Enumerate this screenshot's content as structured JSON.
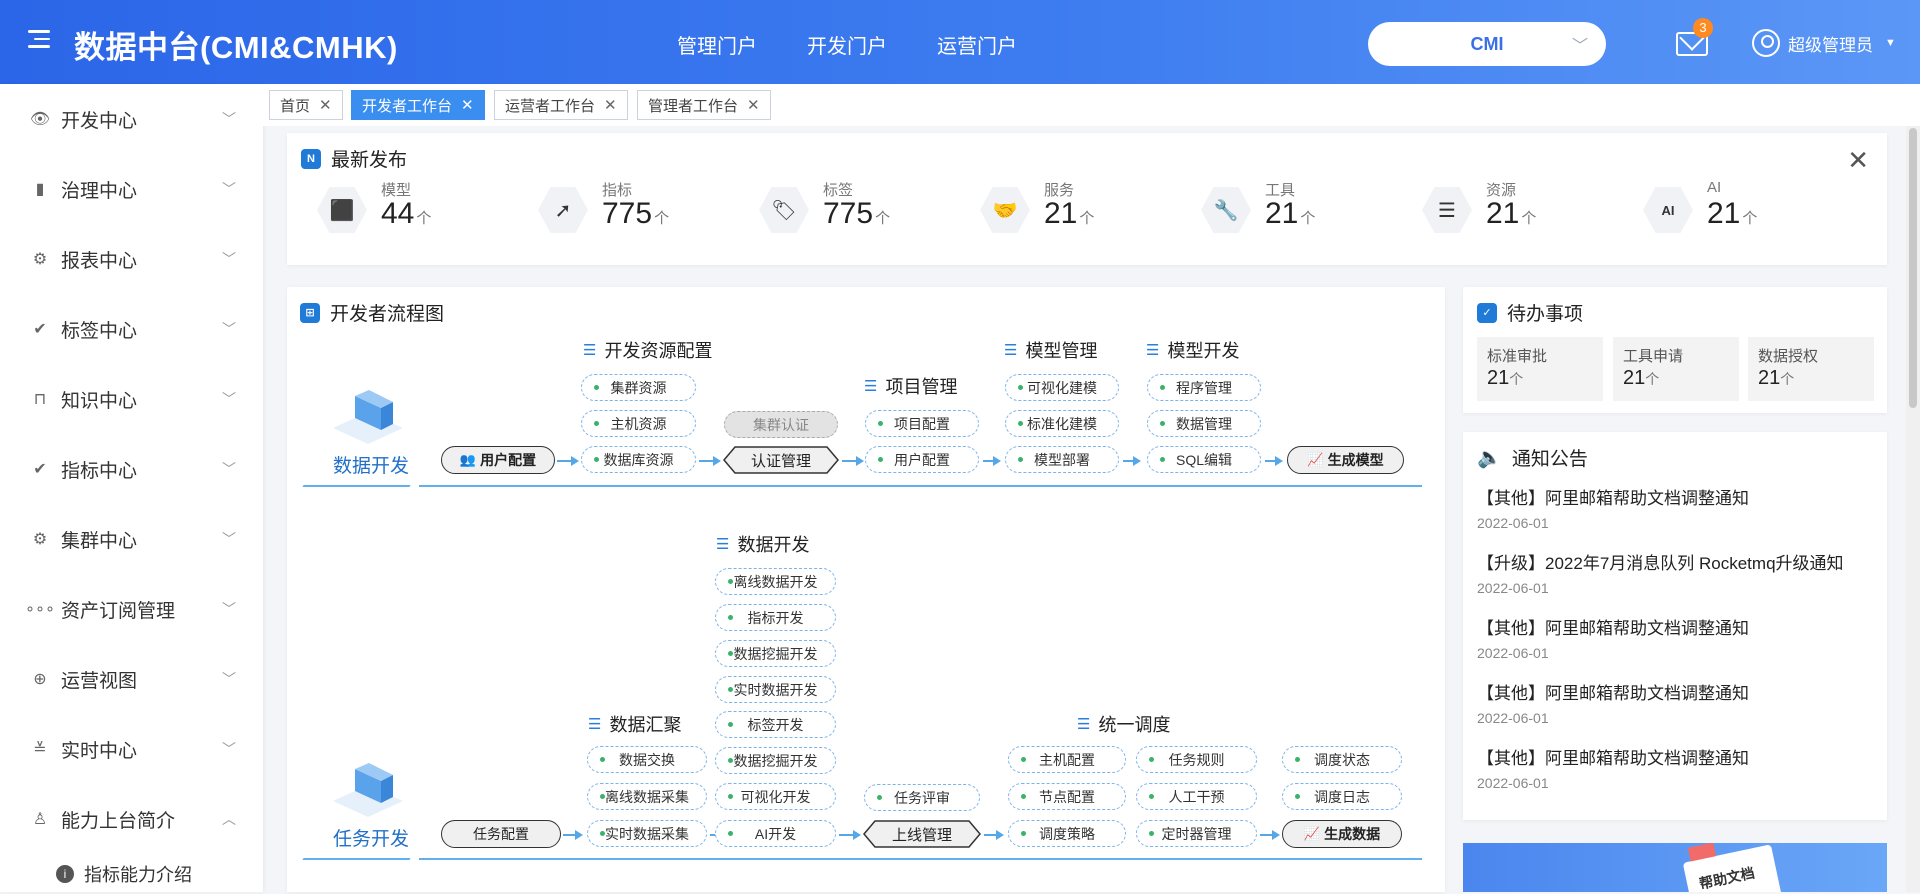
{
  "header": {
    "app_title": "数据中台(CMI&CMHK)",
    "nav": [
      "管理门户",
      "开发门户",
      "运营门户"
    ],
    "tenant": "CMI",
    "mail_badge": "3",
    "user_name": "超级管理员"
  },
  "sidebar": {
    "items": [
      {
        "label": "开发中心",
        "icon": "eye-icon"
      },
      {
        "label": "治理中心",
        "icon": "bar-chart-icon"
      },
      {
        "label": "报表中心",
        "icon": "gear-icon"
      },
      {
        "label": "标签中心",
        "icon": "check-circle-icon"
      },
      {
        "label": "知识中心",
        "icon": "bag-icon"
      },
      {
        "label": "指标中心",
        "icon": "check-circle-icon"
      },
      {
        "label": "集群中心",
        "icon": "gear-icon"
      },
      {
        "label": "资产订阅管理",
        "icon": "dots-icon"
      },
      {
        "label": "运营视图",
        "icon": "plus-circle-icon"
      },
      {
        "label": "实时中心",
        "icon": "list-check-icon"
      },
      {
        "label": "能力上台简介",
        "icon": "user-icon"
      }
    ],
    "sub_item": "指标能力介绍"
  },
  "tabs": [
    {
      "label": "首页",
      "active": false
    },
    {
      "label": "开发者工作台",
      "active": true
    },
    {
      "label": "运营者工作台",
      "active": false
    },
    {
      "label": "管理者工作台",
      "active": false
    }
  ],
  "latest": {
    "title": "最新发布",
    "stats": [
      {
        "label": "模型",
        "value": "44",
        "unit": "个",
        "icon": "cube-icon"
      },
      {
        "label": "指标",
        "value": "775",
        "unit": "个",
        "icon": "trend-icon"
      },
      {
        "label": "标签",
        "value": "775",
        "unit": "个",
        "icon": "tag-icon"
      },
      {
        "label": "服务",
        "value": "21",
        "unit": "个",
        "icon": "handshake-icon"
      },
      {
        "label": "工具",
        "value": "21",
        "unit": "个",
        "icon": "wrench-icon"
      },
      {
        "label": "资源",
        "value": "21",
        "unit": "个",
        "icon": "layers-icon"
      },
      {
        "label": "AI",
        "value": "21",
        "unit": "个",
        "icon": "ai-icon"
      }
    ]
  },
  "flow": {
    "title": "开发者流程图",
    "data_dev": {
      "stage": "数据开发",
      "user_config": "用户配置",
      "res_title": "开发资源配置",
      "res_items": [
        "集群资源",
        "主机资源",
        "数据库资源"
      ],
      "auth_label": "集群认证",
      "auth_mgmt": "认证管理",
      "proj_title": "项目管理",
      "proj_items": [
        "项目配置",
        "用户配置"
      ],
      "model_title": "模型管理",
      "model_items": [
        "可视化建模",
        "标准化建模",
        "模型部署"
      ],
      "mdev_title": "模型开发",
      "mdev_items": [
        "程序管理",
        "数据管理",
        "SQL编辑"
      ],
      "gen_model": "生成模型"
    },
    "task_dev": {
      "stage": "任务开发",
      "task_config": "任务配置",
      "agg_title": "数据汇聚",
      "agg_items": [
        "数据交换",
        "离线数据采集",
        "实时数据采集"
      ],
      "ddev_title": "数据开发",
      "ddev_items": [
        "离线数据开发",
        "指标开发",
        "数据挖掘开发",
        "实时数据开发",
        "标签开发",
        "数据挖掘开发",
        "可视化开发",
        "AI开发"
      ],
      "review": "任务评审",
      "online": "上线管理",
      "sched_title": "统一调度",
      "sched_col1": [
        "主机配置",
        "节点配置",
        "调度策略"
      ],
      "sched_col2": [
        "任务规则",
        "人工干预",
        "定时器管理"
      ],
      "sched_col3": [
        "调度状态",
        "调度日志"
      ],
      "gen_data": "生成数据"
    }
  },
  "todo": {
    "title": "待办事项",
    "items": [
      {
        "label": "标准审批",
        "value": "21",
        "unit": "个"
      },
      {
        "label": "工具申请",
        "value": "21",
        "unit": "个"
      },
      {
        "label": "数据授权",
        "value": "21",
        "unit": "个"
      }
    ]
  },
  "notices": {
    "title": "通知公告",
    "items": [
      {
        "text": "【其他】阿里邮箱帮助文档调整通知",
        "date": "2022-06-01"
      },
      {
        "text": "【升级】2022年7月消息队列 Rocketmq升级通知",
        "date": "2022-06-01"
      },
      {
        "text": "【其他】阿里邮箱帮助文档调整通知",
        "date": "2022-06-01"
      },
      {
        "text": "【其他】阿里邮箱帮助文档调整通知",
        "date": "2022-06-01"
      },
      {
        "text": "【其他】阿里邮箱帮助文档调整通知",
        "date": "2022-06-01"
      }
    ]
  },
  "banner": {
    "text": "帮助文档"
  }
}
